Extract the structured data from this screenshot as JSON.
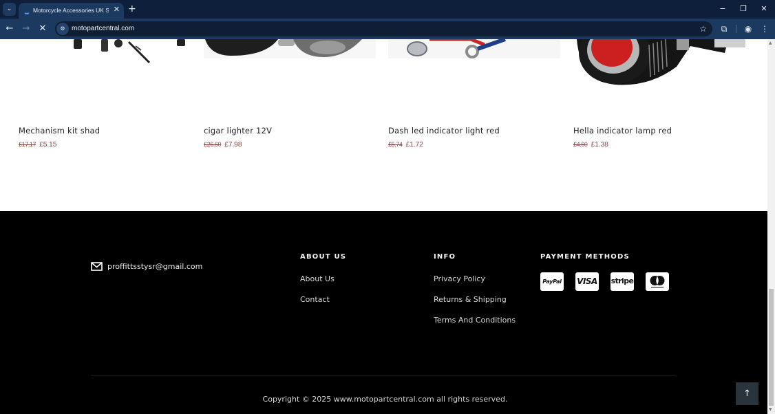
{
  "browser": {
    "tab": {
      "title": "Motorcycle Accessories UK Seller",
      "loading": true
    },
    "url": "motopartcentral.com",
    "icons": {
      "tab_menu": "chevron-down-icon",
      "tab_close": "close-icon",
      "new_tab": "plus-icon",
      "minimize": "minimize-icon",
      "restore": "restore-icon",
      "close_window": "close-icon",
      "back": "arrow-left-icon",
      "forward": "arrow-right-icon",
      "stop": "stop-loading-icon",
      "site_info": "tune-icon",
      "bookmark": "star-icon",
      "extensions": "puzzle-icon",
      "profile": "account-circle-icon",
      "menu": "kebab-menu-icon"
    },
    "glyphs": {
      "tab_menu": "⌄",
      "tab_close": "✕",
      "new_tab": "+",
      "minimize": "−",
      "restore": "❐",
      "close_window": "✕",
      "back": "←",
      "forward": "→",
      "stop": "✕",
      "site_info": "⚙",
      "bookmark": "☆",
      "extensions": "⧉",
      "profile": "◉",
      "menu": "⋮"
    }
  },
  "products": [
    {
      "name": "Mechanism kit shad",
      "old_price": "£17.17",
      "price": "£5.15"
    },
    {
      "name": "cigar lighter 12V",
      "old_price": "£26.60",
      "price": "£7.98"
    },
    {
      "name": "Dash led indicator light red",
      "old_price": "£5.74",
      "price": "£1.72"
    },
    {
      "name": "Hella indicator lamp red",
      "old_price": "£4.60",
      "price": "£1.38"
    }
  ],
  "footer": {
    "email": "proffittsstysr@gmail.com",
    "about": {
      "title": "ABOUT US",
      "links": [
        "About Us",
        "Contact"
      ]
    },
    "info": {
      "title": "INFO",
      "links": [
        "Privacy Policy",
        "Returns & Shipping",
        "Terms And Conditions"
      ]
    },
    "payment": {
      "title": "PAYMENT METHODS",
      "methods": [
        "PayPal",
        "VISA",
        "stripe",
        "mastercard"
      ]
    },
    "copyright": "Copyright © 2025 www.motopartcentral.com all rights reserved.",
    "back_to_top": "↑"
  }
}
